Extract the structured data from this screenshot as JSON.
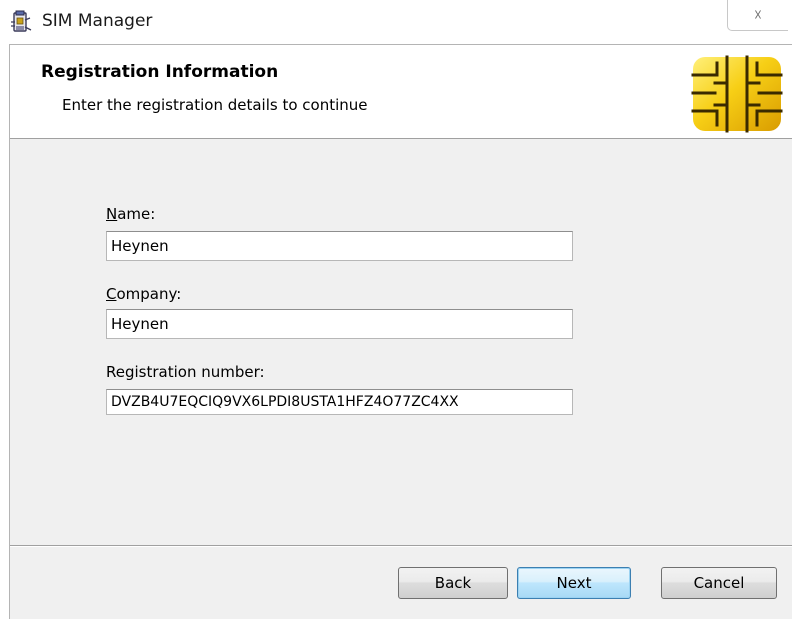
{
  "window": {
    "title": "SIM Manager",
    "close_glyph": "☓",
    "icon": "sim-manager-app-icon"
  },
  "header": {
    "title": "Registration Information",
    "subtitle": "Enter the registration details to continue",
    "image": "sim-chip-icon"
  },
  "form": {
    "name": {
      "label_accel": "N",
      "label_rest": "ame:",
      "value": "Heynen"
    },
    "company": {
      "label_accel": "C",
      "label_rest": "ompany:",
      "value": "Heynen"
    },
    "registration": {
      "label": "Registration number:",
      "value": "DVZB4U7EQCIQ9VX6LPDI8USTA1HFZ4O77ZC4XX"
    }
  },
  "buttons": {
    "back": "Back",
    "next": "Next",
    "cancel": "Cancel"
  },
  "colors": {
    "chip_gold": "#f2c20f",
    "chip_dark": "#c98d00",
    "default_button_border": "#3c7fb1"
  }
}
